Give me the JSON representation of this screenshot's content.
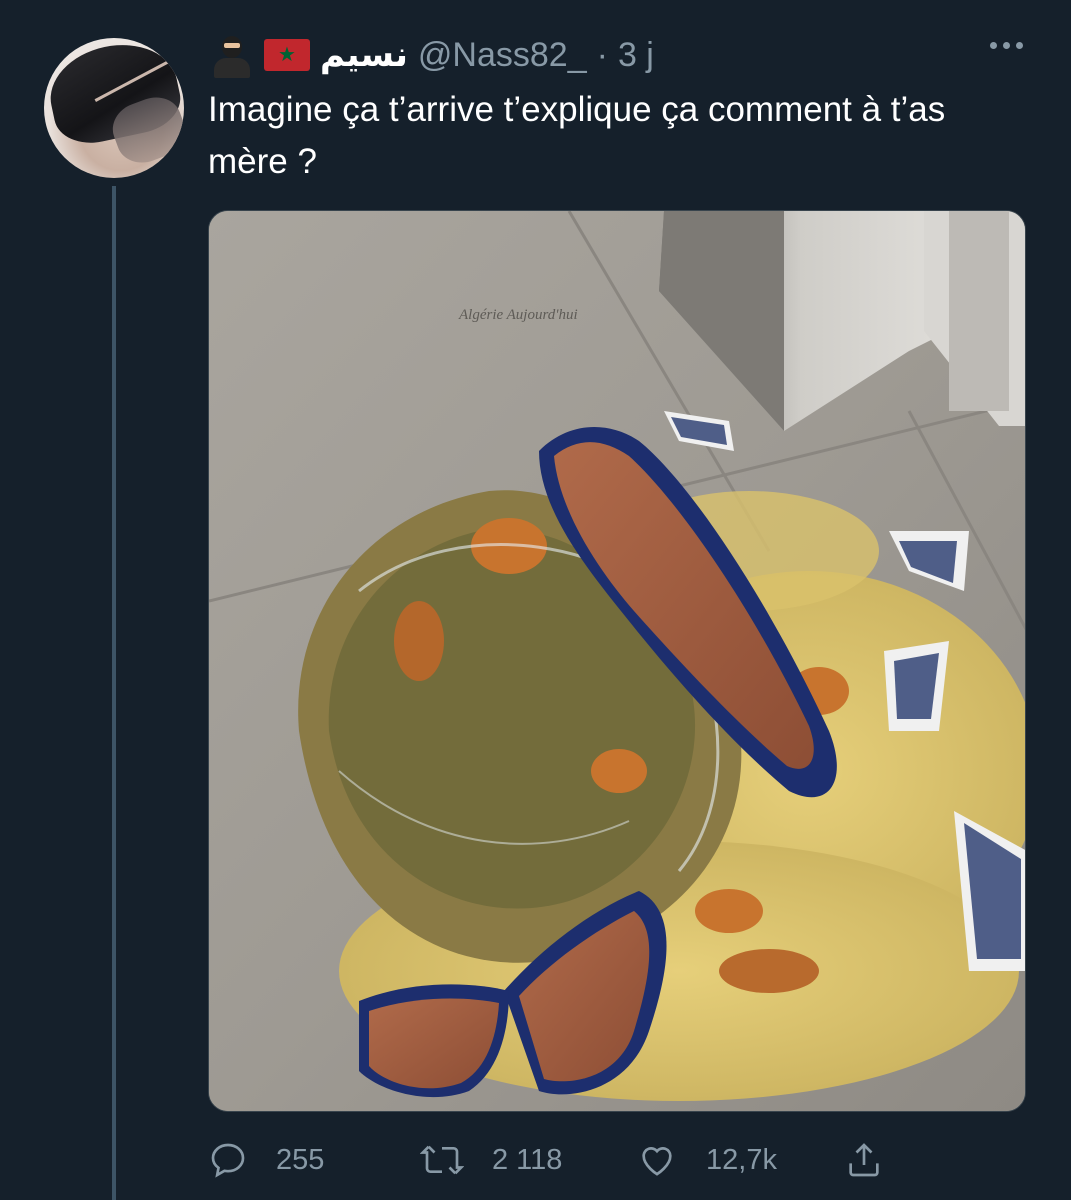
{
  "tweet": {
    "display_name": "نسيم",
    "handle": "@Nass82_",
    "separator": "·",
    "time": "3 j",
    "text": "Imagine ça t’arrive t’explique ça comment à t’as mère ?",
    "image_watermark": "Algérie Aujourd'hui",
    "header_emojis": [
      "ninja-icon",
      "morocco-flag-icon"
    ],
    "actions": {
      "replies": "255",
      "retweets": "2 118",
      "likes": "12,7k"
    }
  },
  "colors": {
    "background": "#15202b",
    "secondary_text": "#8899a6",
    "thread_line": "#3d5466",
    "flag_red": "#c1272d",
    "flag_green": "#006233"
  }
}
